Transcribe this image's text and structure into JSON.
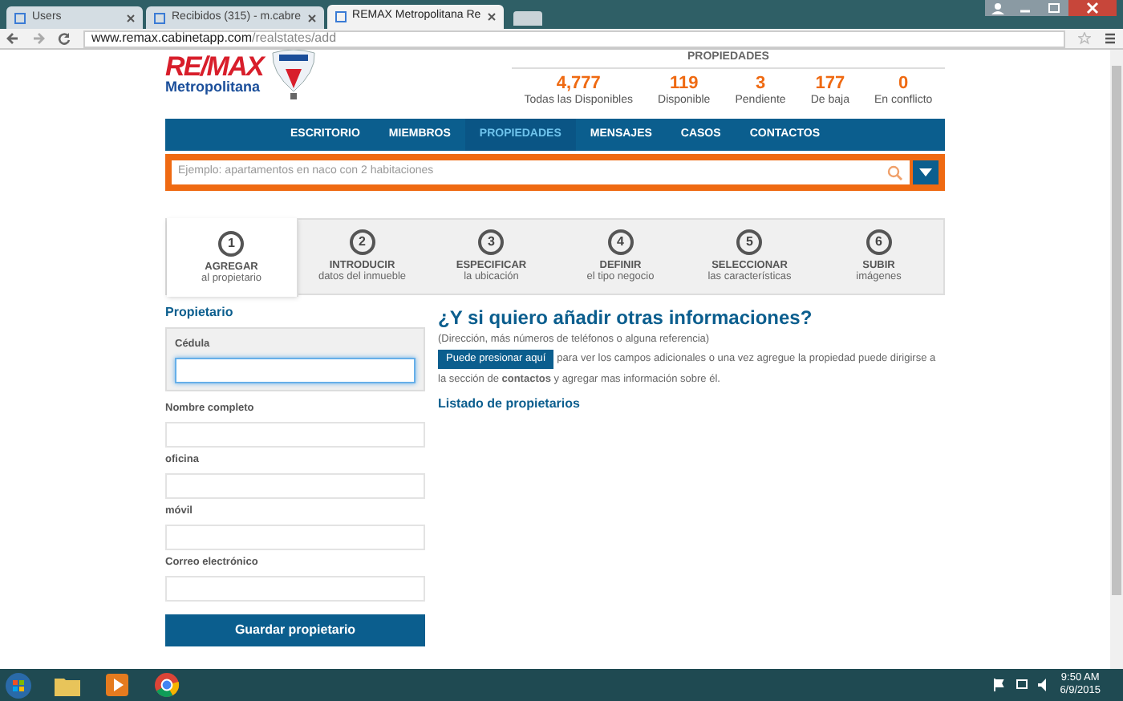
{
  "browser": {
    "tabs": [
      {
        "label": "Users",
        "selected": false
      },
      {
        "label": "Recibidos (315) - m.cabre",
        "selected": false
      },
      {
        "label": "REMAX Metropolitana Re",
        "selected": true
      }
    ],
    "url": {
      "host": "www.remax.cabinetapp.com",
      "path": "/realstates/add"
    }
  },
  "logo": {
    "brand": "RE/MAX",
    "subtitle": "Metropolitana"
  },
  "stats": {
    "title": "PROPIEDADES",
    "items": [
      {
        "value": "4,777",
        "label": "Todas las Disponibles"
      },
      {
        "value": "119",
        "label": "Disponible"
      },
      {
        "value": "3",
        "label": "Pendiente"
      },
      {
        "value": "177",
        "label": "De baja"
      },
      {
        "value": "0",
        "label": "En conflicto"
      }
    ]
  },
  "nav": [
    {
      "label": "ESCRITORIO",
      "selected": false
    },
    {
      "label": "MIEMBROS",
      "selected": false
    },
    {
      "label": "PROPIEDADES",
      "selected": true
    },
    {
      "label": "MENSAJES",
      "selected": false
    },
    {
      "label": "CASOS",
      "selected": false
    },
    {
      "label": "CONTACTOS",
      "selected": false
    }
  ],
  "search": {
    "placeholder": "Ejemplo: apartamentos en naco con 2 habitaciones"
  },
  "steps": [
    {
      "number": "1",
      "title": "AGREGAR",
      "subtitle": "al propietario",
      "selected": true
    },
    {
      "number": "2",
      "title": "INTRODUCIR",
      "subtitle": "datos del inmueble",
      "selected": false
    },
    {
      "number": "3",
      "title": "ESPECIFICAR",
      "subtitle": "la ubicación",
      "selected": false
    },
    {
      "number": "4",
      "title": "DEFINIR",
      "subtitle": "el tipo negocio",
      "selected": false
    },
    {
      "number": "5",
      "title": "SELECCIONAR",
      "subtitle": "las características",
      "selected": false
    },
    {
      "number": "6",
      "title": "SUBIR",
      "subtitle": "imágenes",
      "selected": false
    }
  ],
  "owner_form": {
    "title": "Propietario",
    "fields": [
      {
        "label": "Cédula",
        "focused": true
      },
      {
        "label": "Nombre completo",
        "focused": false
      },
      {
        "label": "oficina",
        "focused": false
      },
      {
        "label": "móvil",
        "focused": false
      },
      {
        "label": "Correo electrónico",
        "focused": false
      }
    ],
    "button": "Guardar propietario"
  },
  "info": {
    "heading": "¿Y si quiero añadir otras informaciones?",
    "note": "(Dirección, más números de teléfonos o alguna referencia)",
    "button": "Puede presionar aquí",
    "text": "para ver los campos adicionales o una vez agregue la propiedad puede dirigirse a la sección de **contactos** y agregar mas información sobre él.",
    "list_title": "Listado de propietarios"
  },
  "taskbar": {
    "time": "9:50 AM",
    "date": "6/9/2015"
  }
}
